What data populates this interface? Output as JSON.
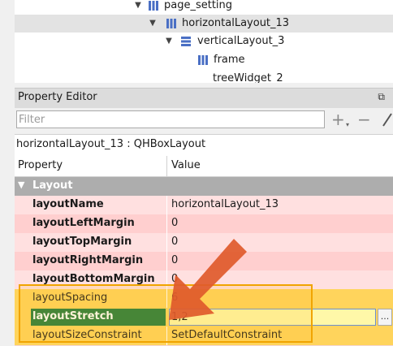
{
  "tree": {
    "items": [
      {
        "label": "page_setting",
        "icon": "horizontal-layout-icon",
        "expanded": true
      },
      {
        "label": "horizontalLayout_13",
        "icon": "horizontal-layout-icon",
        "expanded": true,
        "selected": true
      },
      {
        "label": "verticalLayout_3",
        "icon": "vertical-layout-icon",
        "expanded": true
      },
      {
        "label": "frame",
        "icon": "horizontal-layout-icon",
        "expanded": false
      },
      {
        "label": "treeWidget_2",
        "icon": "",
        "expanded": false
      }
    ]
  },
  "property_editor": {
    "title": "Property Editor",
    "float_button": "⧉",
    "filter_placeholder": "Filter",
    "add_button": "+",
    "remove_button": "−",
    "class_label": "horizontalLayout_13 : QHBoxLayout",
    "headers": {
      "property": "Property",
      "value": "Value"
    },
    "group": "Layout",
    "rows": [
      {
        "name": "layoutName",
        "value": "horizontalLayout_13"
      },
      {
        "name": "layoutLeftMargin",
        "value": "0"
      },
      {
        "name": "layoutTopMargin",
        "value": "0"
      },
      {
        "name": "layoutRightMargin",
        "value": "0"
      },
      {
        "name": "layoutBottomMargin",
        "value": "0"
      },
      {
        "name": "layoutSpacing",
        "value": "6"
      },
      {
        "name": "layoutStretch",
        "value": "1,2"
      },
      {
        "name": "layoutSizeConstraint",
        "value": "SetDefaultConstraint"
      }
    ],
    "dots_button": "..."
  },
  "colors": {
    "pink_row": "#ffcfcf",
    "highlight": "#ffd45c",
    "selected_name": "#1f7a3b",
    "arrow": "#e05a2b"
  }
}
